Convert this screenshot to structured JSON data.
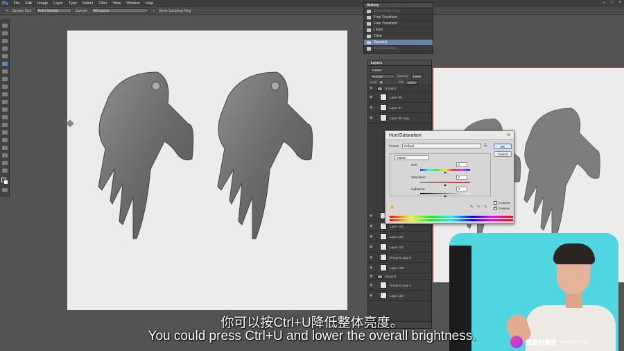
{
  "menubar": {
    "app_logo": "Ps",
    "items": [
      "File",
      "Edit",
      "Image",
      "Layer",
      "Type",
      "Select",
      "Filter",
      "View",
      "Window",
      "Help"
    ]
  },
  "options": {
    "sample_size_label": "Sample Size:",
    "sample_size_value": "Point Sample",
    "sample_label": "Sample:",
    "sample_value": "All Layers",
    "show_ring_label": "Show Sampling Ring"
  },
  "history": {
    "title": "History",
    "items": [
      {
        "label": "Select Row Copy",
        "state": "dim"
      },
      {
        "label": "Free Transform",
        "state": "normal"
      },
      {
        "label": "Free Transform",
        "state": "normal"
      },
      {
        "label": "Lasso",
        "state": "normal"
      },
      {
        "label": "Clear",
        "state": "normal"
      },
      {
        "label": "Deselect",
        "state": "active"
      },
      {
        "label": "Hue/Saturation",
        "state": "dim"
      }
    ]
  },
  "layers": {
    "title": "Layers",
    "kind_label": "Kind",
    "blend_mode": "Normal",
    "opacity_label": "Opacity:",
    "opacity_value": "100%",
    "lock_label": "Lock:",
    "fill_label": "Fill:",
    "fill_value": "100%",
    "rows_top": [
      {
        "name": "Group 5",
        "type": "group"
      },
      {
        "name": "Layer 98",
        "type": "layer"
      },
      {
        "name": "Layer 97",
        "type": "layer"
      },
      {
        "name": "Layer 96 copy",
        "type": "layer"
      }
    ],
    "rows_bottom": [
      {
        "name": "Layer 101 copy 2",
        "type": "layer"
      },
      {
        "name": "Layer 101",
        "type": "layer"
      },
      {
        "name": "Layer 114",
        "type": "layer"
      },
      {
        "name": "Layer 113",
        "type": "layer"
      },
      {
        "name": "Group 8 copy 5",
        "type": "layer"
      },
      {
        "name": "Layer 125",
        "type": "layer"
      },
      {
        "name": "Group 6",
        "type": "group"
      },
      {
        "name": "Group 8 copy 4",
        "type": "layer"
      },
      {
        "name": "Layer 119",
        "type": "layer"
      }
    ]
  },
  "dialog": {
    "title": "Hue/Saturation",
    "preset_label": "Preset:",
    "preset_value": "Default",
    "channel_value": "Master",
    "hue_label": "Hue:",
    "hue_value": "0",
    "saturation_label": "Saturation:",
    "saturation_value": "0",
    "lightness_label": "Lightness:",
    "lightness_value": "0",
    "ok_label": "OK",
    "cancel_label": "Cancel",
    "colorize_label": "Colorize",
    "colorize_checked": false,
    "preview_label": "Preview",
    "preview_checked": true
  },
  "subtitles": {
    "zh": "你可以按Ctrl+U降低整体亮度。",
    "en": "You could press Ctrl+U and lower the overall brightness."
  },
  "watermark": {
    "logo": "fs",
    "cn": "梵摄创意库",
    "url": "www.fstvc.cc"
  }
}
